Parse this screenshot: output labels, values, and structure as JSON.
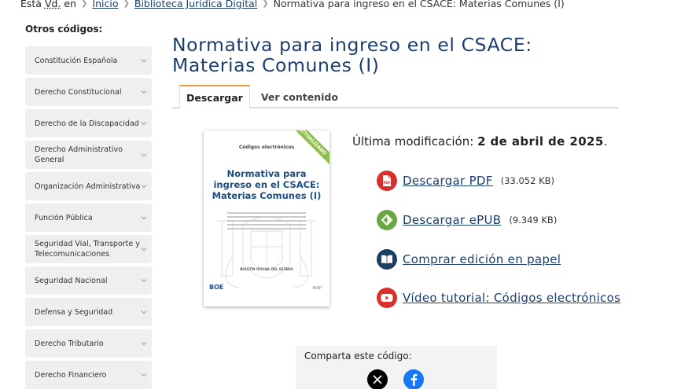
{
  "breadcrumb": {
    "prefix_before": "Está ",
    "abbr": "Vd.",
    "prefix_after": " en",
    "home": "Inicio",
    "section": "Biblioteca Jurídica Digital",
    "current": "Normativa para ingreso en el CSACE: Materias Comunes (I)"
  },
  "sidebar": {
    "heading": "Otros códigos:",
    "items": [
      {
        "label": "Constitución Española"
      },
      {
        "label": "Derecho Constitucional"
      },
      {
        "label": "Derecho de la Discapacidad"
      },
      {
        "label": "Derecho Administrativo General"
      },
      {
        "label": "Organización Administrativa"
      },
      {
        "label": "Función Pública"
      },
      {
        "label": "Seguridad Vial, Transporte y Telecomunicaciones"
      },
      {
        "label": "Seguridad Nacional"
      },
      {
        "label": "Defensa y Seguridad"
      },
      {
        "label": "Derecho Tributario"
      },
      {
        "label": "Derecho Financiero"
      }
    ]
  },
  "page": {
    "title": "Normativa para ingreso en el CSACE: Materias Comunes (I)"
  },
  "tabs": [
    {
      "label": "Descargar",
      "active": true
    },
    {
      "label": "Ver contenido",
      "active": false
    }
  ],
  "cover": {
    "series": "Códigos electrónicos",
    "title": "Normativa para ingreso en el CSACE: Materias Comunes (I)",
    "ribbon": "ACTUALIZADO",
    "publisher": "BOLETÍN OFICIAL DEL ESTADO",
    "logo_text": "BOE",
    "inap_text": "INAP"
  },
  "modification": {
    "label": "Última modificación:",
    "date": "2 de abril de 2025",
    "end": "."
  },
  "downloads": [
    {
      "label": "Descargar PDF",
      "size": "(33.052 KB)",
      "icon": "pdf-icon",
      "color": "#d9302b"
    },
    {
      "label": "Descargar ePUB",
      "size": "(9.349 KB)",
      "icon": "epub-icon",
      "color": "#6aa641"
    },
    {
      "label": "Comprar edición en papel",
      "size": "",
      "icon": "book-icon",
      "color": "#1d3f62"
    },
    {
      "label": "Vídeo tutorial: Códigos electrónicos",
      "size": "",
      "icon": "youtube-icon",
      "color": "#d9302b"
    }
  ],
  "share": {
    "label": "Comparta este código:",
    "networks": [
      "x-icon",
      "facebook-icon"
    ]
  }
}
